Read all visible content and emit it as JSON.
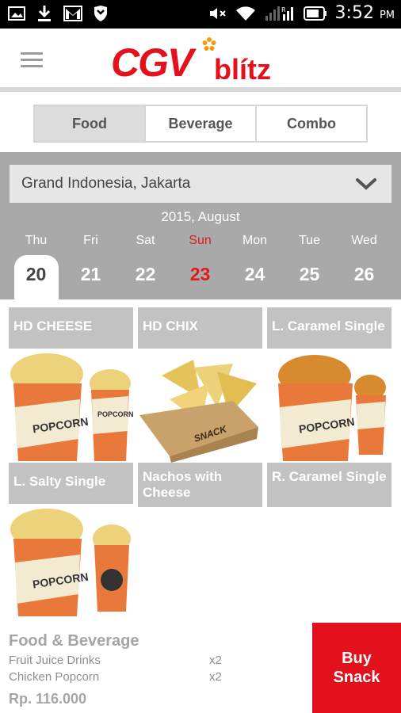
{
  "status_bar": {
    "time": "3:52",
    "ampm": "PM",
    "icons": [
      "image-icon",
      "download-icon",
      "gmail-icon",
      "shield-icon",
      "mute-icon",
      "wifi-icon",
      "signal-icon",
      "battery-icon"
    ]
  },
  "header": {
    "logo_text": "CGV blitz"
  },
  "tabs": [
    {
      "label": "Food",
      "active": true
    },
    {
      "label": "Beverage",
      "active": false
    },
    {
      "label": "Combo",
      "active": false
    }
  ],
  "location": {
    "selected": "Grand Indonesia, Jakarta"
  },
  "calendar": {
    "month_label": "2015, August",
    "days": [
      {
        "name": "Thu",
        "date": "20",
        "active": true
      },
      {
        "name": "Fri",
        "date": "21"
      },
      {
        "name": "Sat",
        "date": "22"
      },
      {
        "name": "Sun",
        "date": "23",
        "sunday": true
      },
      {
        "name": "Mon",
        "date": "24"
      },
      {
        "name": "Tue",
        "date": "25"
      },
      {
        "name": "Wed",
        "date": "26"
      }
    ]
  },
  "products": {
    "top_row": [
      "HD CHEESE",
      "HD CHIX",
      "L. Caramel Single"
    ],
    "items": [
      {
        "label": "L. Salty Single"
      },
      {
        "label": "Nachos with Cheese"
      },
      {
        "label": "R. Caramel Single"
      },
      {
        "label": ""
      }
    ]
  },
  "summary": {
    "title": "Food & Beverage",
    "rows": [
      {
        "name": "Fruit Juice Drinks",
        "qty": "x2"
      },
      {
        "name": "Chicken Popcorn",
        "qty": "x2"
      }
    ],
    "total": "Rp. 116.000"
  },
  "buy_button": {
    "line1": "Buy",
    "line2": "Snack"
  },
  "colors": {
    "brand_red": "#e2111b",
    "panel_grey": "#a9a9a9",
    "label_grey": "#c2c2c2"
  }
}
